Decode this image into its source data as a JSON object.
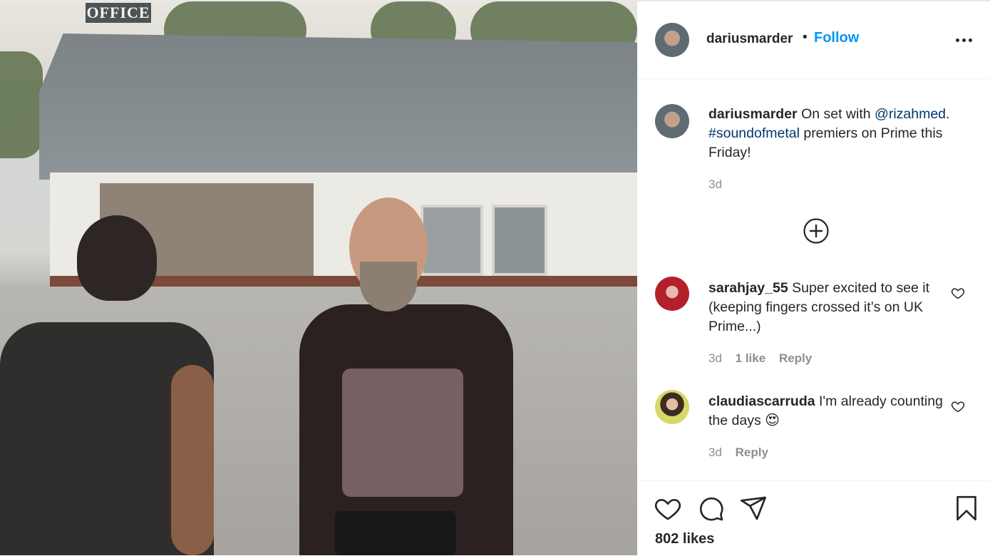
{
  "photo": {
    "sign_text": "OFFICE"
  },
  "post": {
    "author": "dariusmarder",
    "dot": "•",
    "follow_label": "Follow",
    "caption": {
      "username": "dariusmarder",
      "text_1": "On set with",
      "mention": "@rizahmed",
      "text_2": ".",
      "hashtag": "#soundofmetal",
      "text_3": "premiers on Prime this Friday!",
      "time": "3d"
    },
    "comments": [
      {
        "username": "sarahjay_55",
        "text": "Super excited to see it (keeping fingers crossed it’s on UK Prime...)",
        "time": "3d",
        "likes": "1 like",
        "reply_label": "Reply"
      },
      {
        "username": "claudiascarruda",
        "text": "I'm already counting the days",
        "emoji": "😍",
        "time": "3d",
        "reply_label": "Reply"
      }
    ],
    "likes_count": "802 likes"
  },
  "icons": {
    "like": "heart-icon",
    "comment": "comment-icon",
    "share": "paper-plane-icon",
    "save": "bookmark-icon",
    "more": "more-options-icon",
    "load_more": "plus-circle-icon"
  },
  "colors": {
    "follow_blue": "#0095f6",
    "link_blue": "#00376b",
    "text": "#262626",
    "muted": "#8e8e8e"
  }
}
